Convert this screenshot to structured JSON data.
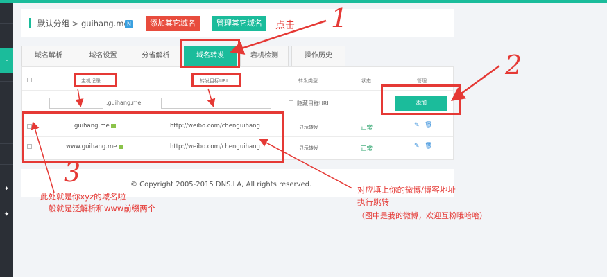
{
  "header": {
    "breadcrumb": "默认分组 > guihang.me",
    "badge": "N",
    "add_domain_btn": "添加其它域名",
    "manage_domain_btn": "管理其它域名"
  },
  "tabs": [
    {
      "label": "域名解析",
      "active": false
    },
    {
      "label": "域名设置",
      "active": false
    },
    {
      "label": "分省解析",
      "active": false
    },
    {
      "label": "域名转发",
      "active": true
    },
    {
      "label": "宕机检测",
      "active": false
    },
    {
      "label": "操作历史",
      "active": false
    }
  ],
  "table": {
    "headers": [
      "主机记录",
      "转发目标URL",
      "转发类型",
      "状态",
      "管理"
    ],
    "new_row": {
      "host_value": "",
      "domain_suffix": ".guihang.me",
      "url_value": "",
      "hide_url_label": "隐藏目标URL",
      "add_btn": "添加"
    },
    "rows": [
      {
        "host": "guihang.me",
        "url": "http://weibo.com/chenguihang",
        "type": "显示转发",
        "status": "正常"
      },
      {
        "host": "www.guihang.me",
        "url": "http://weibo.com/chenguihang",
        "type": "显示转发",
        "status": "正常"
      }
    ]
  },
  "footer": {
    "copyright": "© Copyright 2005-2015 DNS.LA, All rights reserved."
  },
  "annotations": {
    "click": "点击",
    "num1": "1",
    "num2": "2",
    "num3": "3",
    "note3_line1": "此处就是你xyz的域名啦",
    "note3_line2": "一般就是泛解析和www前缀两个",
    "note_url_line1": "对应填上你的微博/博客地址",
    "note_url_line2": "执行跳转",
    "note_url_line3": "（图中是我的微博，欢迎互粉哦哈哈）"
  },
  "colors": {
    "accent": "#1bbc9b",
    "danger": "#e84c3d",
    "annotation": "#e53935"
  },
  "icons": {
    "edit": "pencil-icon",
    "delete": "trash-icon",
    "flag": "flag-icon"
  }
}
